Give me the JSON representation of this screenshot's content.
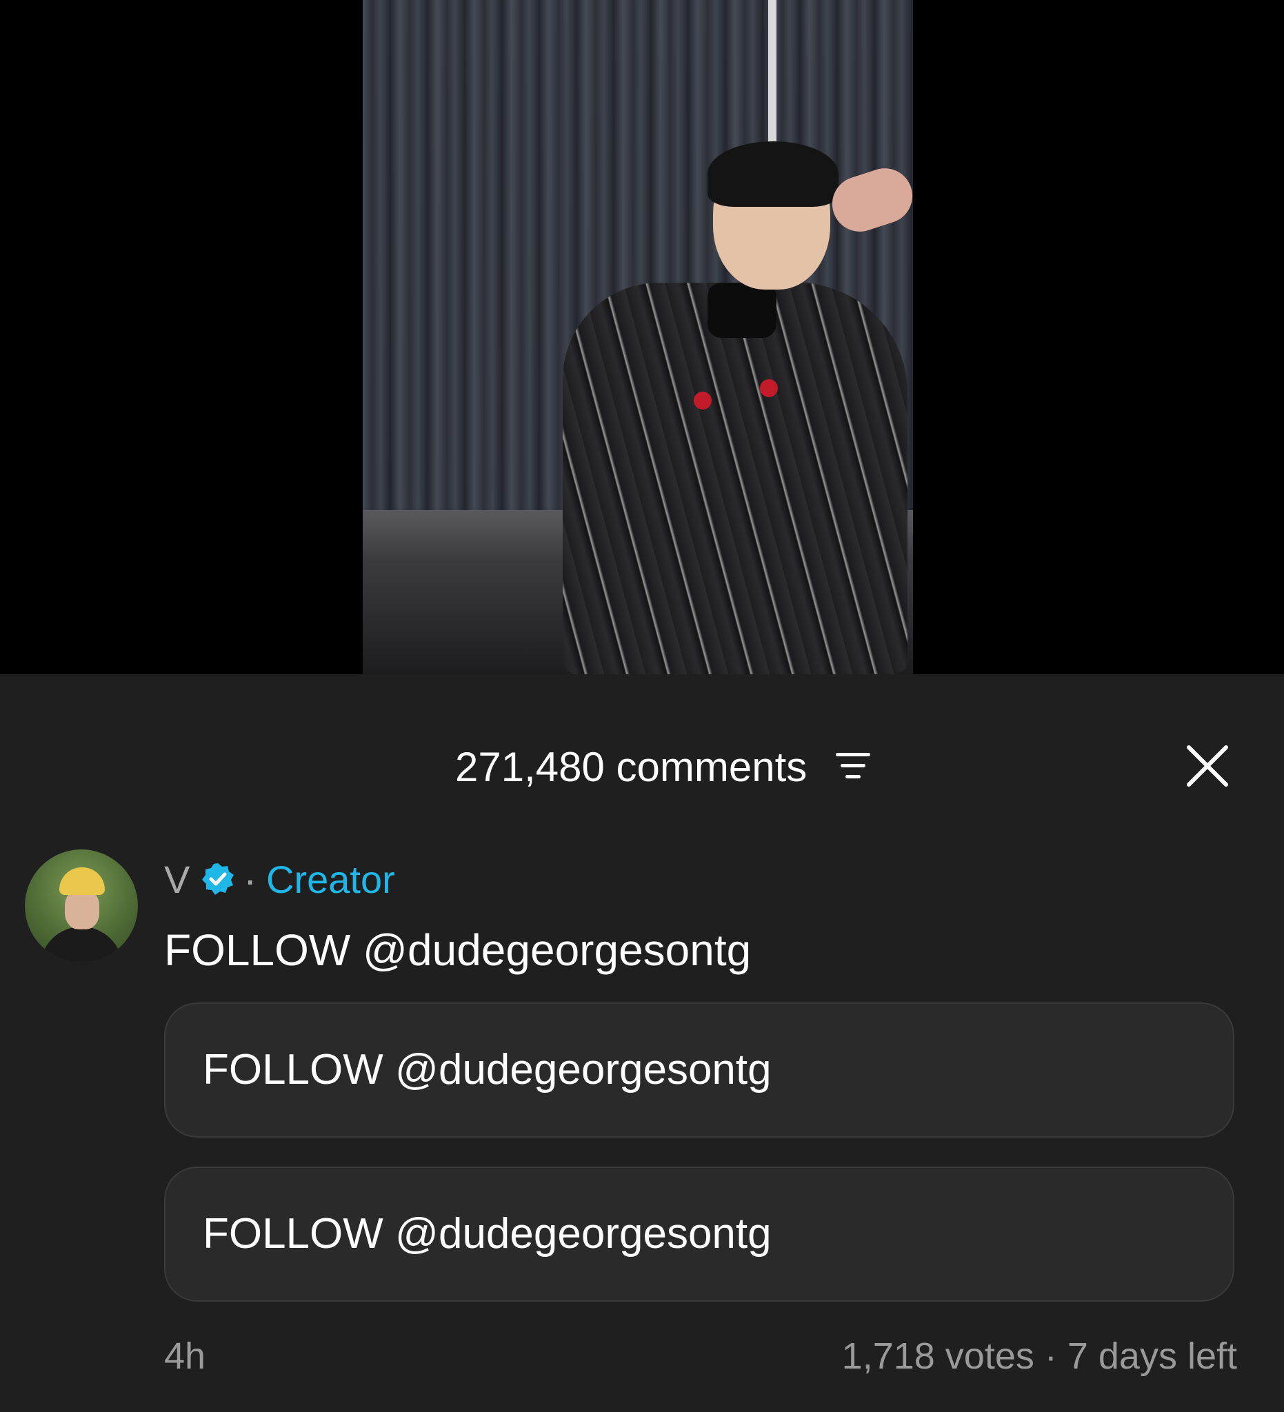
{
  "comments_panel": {
    "count_label": "271,480 comments",
    "filter_icon": "filter-icon",
    "close_icon": "close-icon"
  },
  "comment": {
    "author": "V",
    "verified_icon": "verified-badge-icon",
    "separator": "·",
    "badge": "Creator",
    "text": "FOLLOW @dudegeorgesontg",
    "time": "4h"
  },
  "poll": {
    "options": [
      {
        "label": "FOLLOW @dudegeorgesontg"
      },
      {
        "label": "FOLLOW @dudegeorgesontg"
      }
    ],
    "meta": "1,718 votes · 7 days left"
  },
  "colors": {
    "panel_bg": "#1f1f1f",
    "creator_accent": "#1fb6e8",
    "muted_text": "#9a9a9a"
  }
}
